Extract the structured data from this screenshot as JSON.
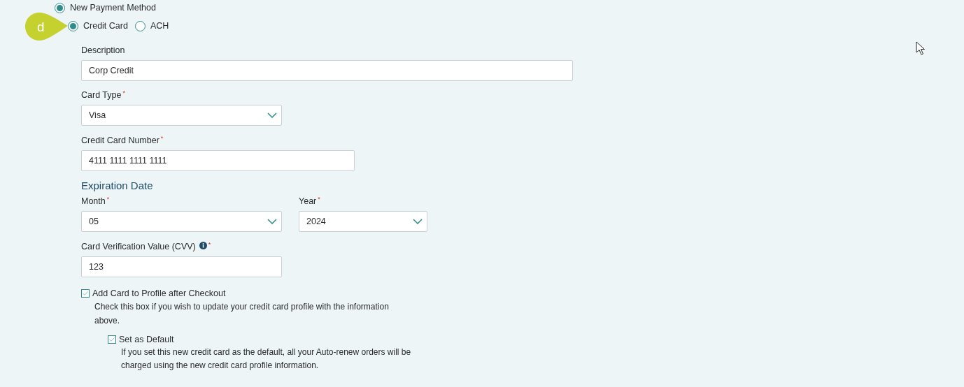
{
  "callout": {
    "label": "d"
  },
  "payment_option": {
    "label": "New Payment Method",
    "selected": true
  },
  "method_options": [
    {
      "label": "Credit Card",
      "selected": true
    },
    {
      "label": "ACH",
      "selected": false
    }
  ],
  "description": {
    "label": "Description",
    "value": "Corp Credit"
  },
  "card_type": {
    "label": "Card Type",
    "required_mark": "*",
    "value": "Visa"
  },
  "card_number": {
    "label": "Credit Card Number",
    "required_mark": "*",
    "value": "4111 1111 1111 1111"
  },
  "expiration": {
    "heading": "Expiration Date",
    "month": {
      "label": "Month",
      "required_mark": "*",
      "value": "05"
    },
    "year": {
      "label": "Year",
      "required_mark": "*",
      "value": "2024"
    }
  },
  "cvv": {
    "label": "Card Verification Value (CVV)",
    "required_mark": "*",
    "value": "123"
  },
  "options": [
    {
      "label": "Add Card to Profile after Checkout",
      "checked": true,
      "help": "Check this box if you wish to update your credit card profile with the information above.",
      "children": [
        {
          "label": "Set as Default",
          "checked": true,
          "help": "If you set this new credit card as the default, all your Auto-renew orders will be charged using the new credit card profile information."
        }
      ]
    }
  ]
}
